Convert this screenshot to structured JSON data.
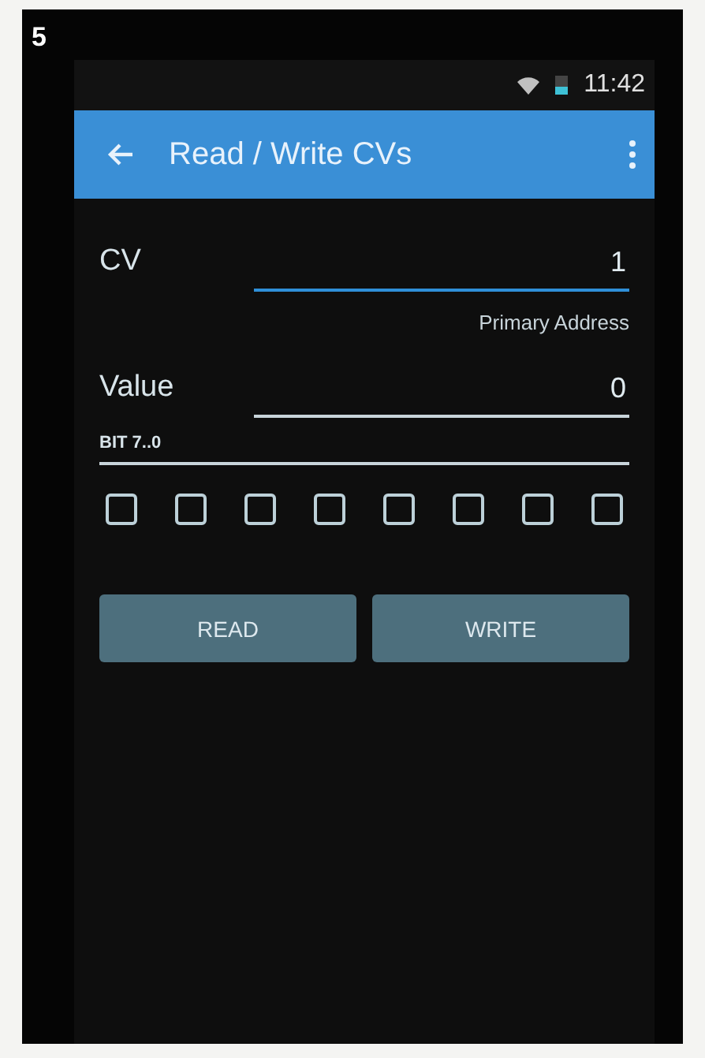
{
  "figure_number": "5",
  "status_bar": {
    "time": "11:42"
  },
  "app_bar": {
    "title": "Read / Write CVs"
  },
  "fields": [
    {
      "label": "CV",
      "value": "1",
      "focused": true,
      "helper": "Primary Address"
    },
    {
      "label": "Value",
      "value": "0",
      "focused": false
    }
  ],
  "bits": {
    "label": "BIT 7..0",
    "checkboxes": [
      {
        "checked": false
      },
      {
        "checked": false
      },
      {
        "checked": false
      },
      {
        "checked": false
      },
      {
        "checked": false
      },
      {
        "checked": false
      },
      {
        "checked": false
      },
      {
        "checked": false
      }
    ]
  },
  "buttons": [
    "READ",
    "WRITE"
  ]
}
